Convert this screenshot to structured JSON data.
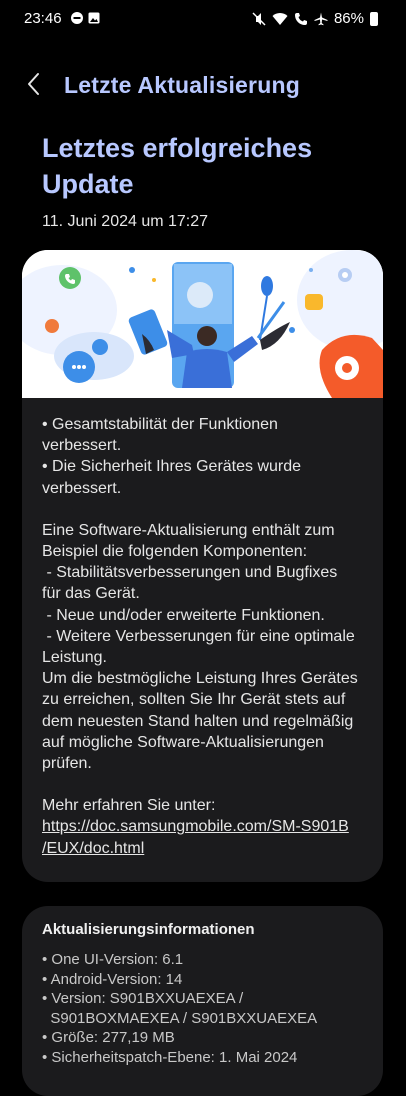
{
  "status_bar": {
    "time": "23:46",
    "battery": "86%",
    "icons": [
      "do-not-disturb-icon",
      "image-icon",
      "mute-icon",
      "wifi-icon",
      "wifi-call-icon",
      "airplane-mode-icon",
      "battery-icon"
    ]
  },
  "header": {
    "title": "Letzte Aktualisierung",
    "back_icon": "back-chevron-icon"
  },
  "main": {
    "heading_line1": "Letztes erfolgreiches",
    "heading_line2": "Update",
    "date": "11. Juni 2024 um 17:27"
  },
  "card": {
    "lines": [
      "• Gesamtstabilität der Funktionen",
      "verbessert.",
      "• Die Sicherheit Ihres Gerätes wurde",
      "verbessert.",
      "",
      "Eine Software-Aktualisierung enthält zum",
      "Beispiel die folgenden Komponenten:",
      " - Stabilitätsverbesserungen und Bugfixes",
      "für das Gerät.",
      " - Neue und/oder erweiterte Funktionen.",
      " - Weitere Verbesserungen für eine optimale",
      "Leistung.",
      "Um die bestmögliche Leistung Ihres Gerätes",
      "zu erreichen, sollten Sie Ihr Gerät stets auf",
      "dem neuesten Stand halten und regelmäßig",
      "auf mögliche Software-Aktualisierungen",
      "prüfen.",
      "",
      "Mehr erfahren Sie unter:"
    ],
    "link_line1": "https://doc.samsungmobile.com/SM-S901B",
    "link_line2": "/EUX/doc.html"
  },
  "info": {
    "title": "Aktualisierungsinformationen",
    "items": [
      "• One UI-Version: 6.1",
      "• Android-Version: 14",
      "• Version: S901BXXUAEXEA /",
      "  S901BOXMAEXEA / S901BXXUAEXEA",
      "• Größe: 277,19 MB",
      "• Sicherheitspatch-Ebene: 1. Mai 2024"
    ]
  },
  "colors": {
    "accent": "#b8c8ff",
    "background": "#000000",
    "card": "#1b1b1d"
  }
}
